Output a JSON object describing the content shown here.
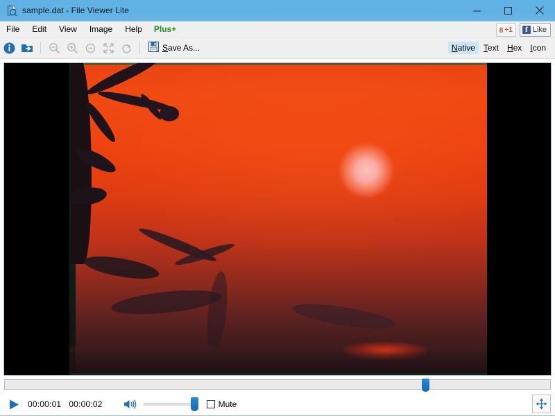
{
  "window": {
    "title": "sample.dat - File Viewer Lite",
    "icon": "document-viewer-icon",
    "controls": {
      "minimize": "minimize-icon",
      "maximize": "maximize-icon",
      "close": "close-icon"
    }
  },
  "menubar": {
    "items": [
      {
        "label": "File"
      },
      {
        "label": "Edit"
      },
      {
        "label": "View"
      },
      {
        "label": "Image"
      },
      {
        "label": "Help"
      },
      {
        "label": "Plus+",
        "accent": "#1a9421"
      }
    ],
    "social": {
      "gplus_symbol": "8",
      "gplus_count": "+1",
      "facebook_f": "f",
      "facebook_label": "Like"
    }
  },
  "toolbar": {
    "buttons": [
      {
        "name": "info-icon",
        "enabled": true
      },
      {
        "name": "open-with-icon",
        "enabled": true
      },
      {
        "name": "zoom-out-icon",
        "enabled": false
      },
      {
        "name": "zoom-in-icon",
        "enabled": false
      },
      {
        "name": "zoom-reset-icon",
        "enabled": false
      },
      {
        "name": "fit-screen-icon",
        "enabled": false
      },
      {
        "name": "rotate-icon",
        "enabled": false
      }
    ],
    "save_as_label_prefix": "S",
    "save_as_label_rest": "ave As...",
    "view_modes": [
      {
        "key": "native",
        "accel": "N",
        "rest": "ative",
        "active": true
      },
      {
        "key": "text",
        "accel": "T",
        "rest": "ext",
        "active": false
      },
      {
        "key": "hex",
        "accel": "H",
        "rest": "ex",
        "active": false
      },
      {
        "key": "icon",
        "accel": "I",
        "rest": "con",
        "active": false
      }
    ]
  },
  "viewer": {
    "content_type": "video-frame",
    "description": "Sunset over trees with large pink-white sun in orange sky, letterboxed with black bars"
  },
  "player": {
    "seek_percent": 76.5,
    "play_label": "play-icon",
    "current_time": "00:00:01",
    "total_time": "00:00:02",
    "volume_icon": "speaker-icon",
    "volume_percent": 100,
    "mute_label": "Mute",
    "mute_checked": false,
    "fullscreen_icon": "fullscreen-icon"
  },
  "colors": {
    "titlebar": "#61b2e4",
    "accent_blue": "#1667b4",
    "plus_green": "#1a9421",
    "selection": "#cde6f7",
    "chrome": "#f0f0f0"
  }
}
